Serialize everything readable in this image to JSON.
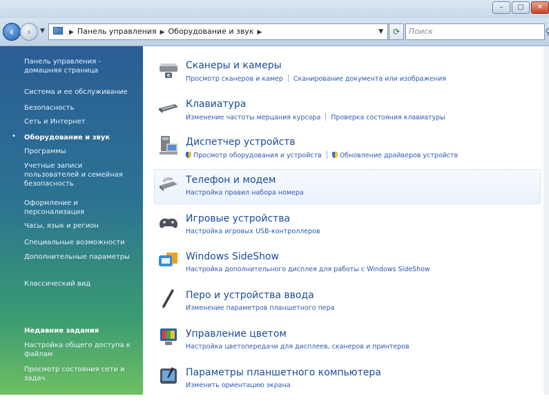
{
  "address": {
    "path": [
      "Панель управления",
      "Оборудование и звук"
    ],
    "search_placeholder": "Поиск"
  },
  "sidebar": {
    "links": [
      "Панель управления - домашняя страница",
      "Система и ее обслуживание",
      "Безопасность",
      "Сеть и Интернет",
      "Оборудование и звук",
      "Программы",
      "Учетные записи пользователей и семейная безопасность",
      "Оформление и персонализация",
      "Часы, язык и регион",
      "Специальные возможности",
      "Дополнительные параметры",
      "Классический вид"
    ],
    "active_index": 4,
    "tasks_heading": "Недавние задания",
    "tasks": [
      "Настройка общего доступа к файлам",
      "Просмотр состояния сети и задач"
    ]
  },
  "categories": [
    {
      "title": "Сканеры и камеры",
      "icon": "scanner-icon",
      "links": [
        "Просмотр сканеров и камер",
        "Сканирование документа или изображения"
      ]
    },
    {
      "title": "Клавиатура",
      "icon": "keyboard-icon",
      "links": [
        "Изменение частоты мерцания курсора",
        "Проверка состояния клавиатуры"
      ]
    },
    {
      "title": "Диспетчер устройств",
      "icon": "device-manager-icon",
      "links": [
        "Просмотр оборудования и устройств",
        "Обновление драйверов устройств"
      ]
    },
    {
      "title": "Телефон и модем",
      "icon": "phone-modem-icon",
      "links": [
        "Настройка правил набора номера"
      ]
    },
    {
      "title": "Игровые устройства",
      "icon": "gamepad-icon",
      "links": [
        "Настройка игровых USB-контроллеров"
      ]
    },
    {
      "title": "Windows SideShow",
      "icon": "sideshow-icon",
      "links": [
        "Настройка дополнительного дисплея для работы с Windows SideShow"
      ]
    },
    {
      "title": "Перо и устройства ввода",
      "icon": "pen-icon",
      "links": [
        "Изменение параметров планшетного пера"
      ]
    },
    {
      "title": "Управление цветом",
      "icon": "color-management-icon",
      "links": [
        "Настройка цветопередачи для дисплеев, сканеров и принтеров"
      ]
    },
    {
      "title": "Параметры планшетного компьютера",
      "icon": "tablet-icon",
      "links": [
        "Изменить ориентацию экрана"
      ]
    }
  ]
}
